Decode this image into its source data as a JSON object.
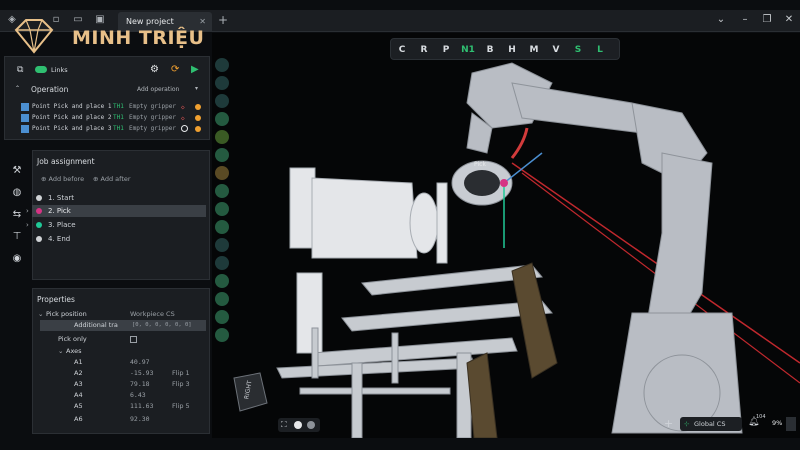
{
  "titlebar": {
    "tab_label": "New project",
    "tab_add": "+",
    "icons": [
      "logo-icon",
      "new-file-icon",
      "open-folder-icon",
      "save-icon"
    ]
  },
  "logo": {
    "text": "MINH TRIỆU",
    "accent": "#e8c089"
  },
  "left_toolbar": {
    "links_label": "Links"
  },
  "operation": {
    "title": "Operation",
    "add_label": "Add operation",
    "rows": [
      {
        "name": "Point Pick and place 1",
        "tool": "TH1",
        "gripper": "Empty gripper"
      },
      {
        "name": "Point Pick and place 2",
        "tool": "TH1",
        "gripper": "Empty gripper"
      },
      {
        "name": "Point Pick and place 3",
        "tool": "TH1",
        "gripper": "Empty gripper"
      }
    ]
  },
  "job": {
    "title": "Job assignment",
    "add_before": "Add before",
    "add_after": "Add after",
    "items": [
      {
        "label": "1. Start",
        "color": "#d0d3d6"
      },
      {
        "label": "2. Pick",
        "color": "#d63384"
      },
      {
        "label": "3. Place",
        "color": "#20c997"
      },
      {
        "label": "4. End",
        "color": "#d0d3d6"
      }
    ]
  },
  "properties": {
    "title": "Properties",
    "pick_position_label": "Pick position",
    "pick_position_value": "Workpiece CS",
    "additional_label": "Additional tra",
    "additional_value": "[0, 0, 0, 0, 0, 0]",
    "pick_only_label": "Pick only",
    "axes_label": "Axes",
    "axes": [
      {
        "name": "A1",
        "value": "40.97",
        "flip": ""
      },
      {
        "name": "A2",
        "value": "-15.93",
        "flip": "Flip 1"
      },
      {
        "name": "A3",
        "value": "79.18",
        "flip": "Flip 3"
      },
      {
        "name": "A4",
        "value": "6.43",
        "flip": ""
      },
      {
        "name": "A5",
        "value": "111.63",
        "flip": "Flip 5"
      },
      {
        "name": "A6",
        "value": "92.30",
        "flip": ""
      }
    ]
  },
  "viewport": {
    "top_tools": [
      "C",
      "R",
      "P",
      "N1",
      "B",
      "H",
      "M",
      "V",
      "S",
      "L"
    ],
    "status": {
      "cs_label": "Global CS",
      "perf_small": "104",
      "perf": "9%",
      "add": "+"
    },
    "pick_marker": "Pick"
  },
  "colors": {
    "panel": "#1b1e22",
    "viewport": "#050607",
    "robot": "#b9bdc4"
  }
}
